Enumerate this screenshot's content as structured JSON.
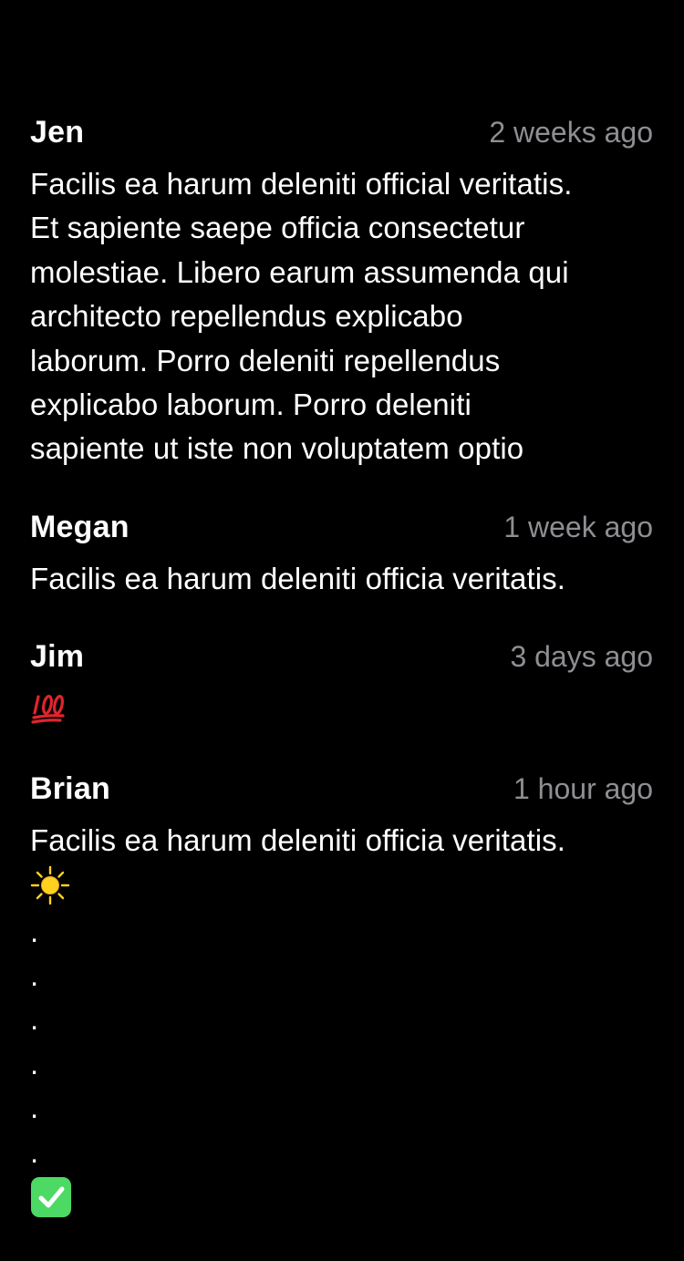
{
  "comments": [
    {
      "author": "Jen",
      "time": "2 weeks ago",
      "text": "Facilis ea harum deleniti official veritatis.\nEt sapiente saepe officia consectetur\nmolestiae. Libero earum assumenda qui\narchitecto repellendus explicabo\nlaborum. Porro deleniti repellendus\nexplicabo laborum. Porro deleniti\nsapiente ut iste non voluptatem optio"
    },
    {
      "author": "Megan",
      "time": "1 week ago",
      "text": "Facilis ea harum deleniti officia veritatis."
    },
    {
      "author": "Jim",
      "time": "3 days ago",
      "emoji": "hundred-points-icon"
    },
    {
      "author": "Brian",
      "time": "1 hour ago",
      "text": "Facilis ea harum deleniti officia veritatis.",
      "emoji_sun": "sun-icon",
      "dots": [
        ".",
        ".",
        ".",
        ".",
        ".",
        "."
      ],
      "emoji_check": "check-mark-icon"
    }
  ],
  "colors": {
    "background": "#000000",
    "text": "#ffffff",
    "timestamp": "#8e8e93",
    "hundred_red": "#e0242c",
    "sun_yellow": "#ffd21e",
    "check_green": "#4cd964"
  }
}
